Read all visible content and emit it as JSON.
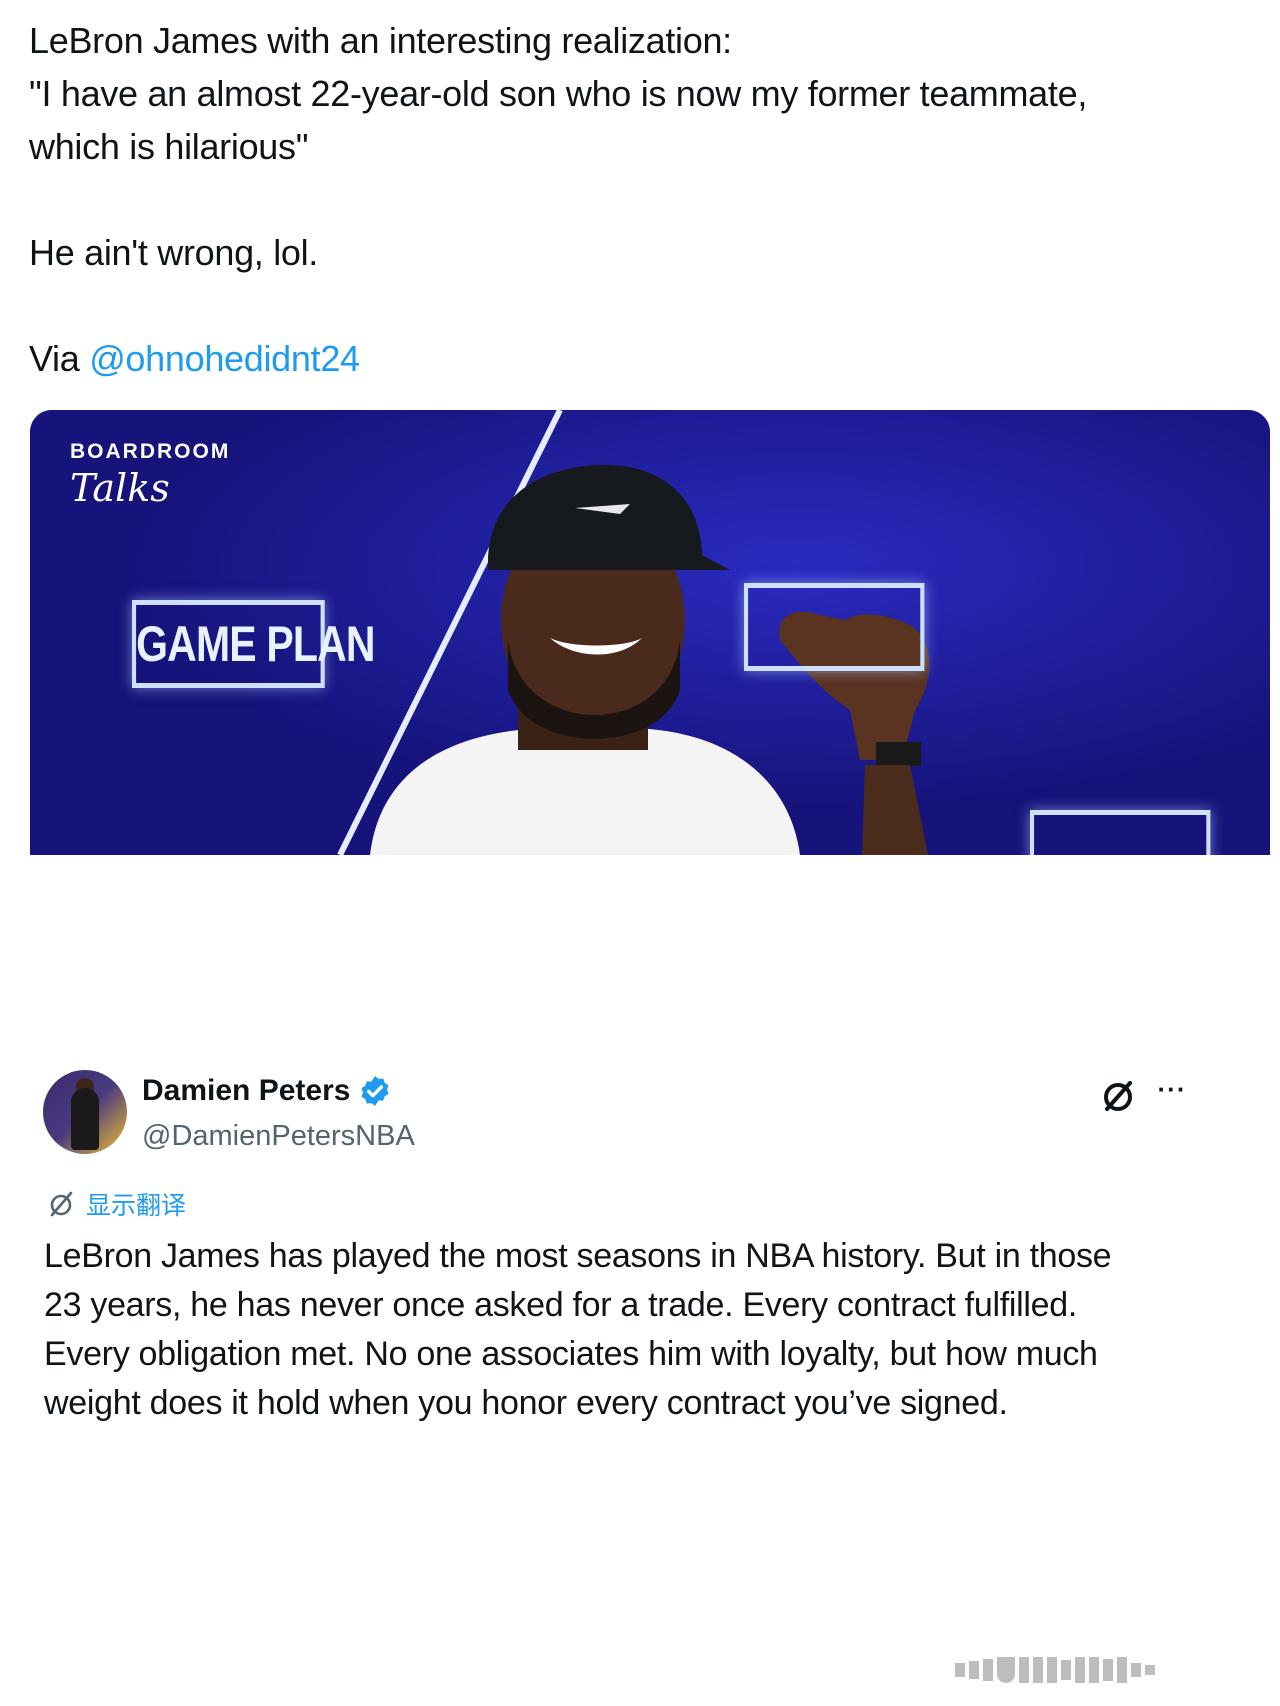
{
  "tweet1": {
    "lines": [
      "LeBron James with an interesting realization:",
      "\"I have an almost 22-year-old son who is now my former teammate,",
      "which is hilarious\"",
      "He ain't wrong, lol."
    ],
    "via_prefix": "Via ",
    "via_mention": "@ohnohedidnt24"
  },
  "media": {
    "brand_top": "BOARDROOM",
    "brand_bottom": "Talks",
    "sign_text": "GAME PLAN",
    "colors": {
      "background": "#1e1a96",
      "sign": "#cfe0ff"
    }
  },
  "tweet2": {
    "display_name": "Damien Peters",
    "handle": "@DamienPetersNBA",
    "translate_label": "显示翻译",
    "more_label": "···",
    "lines": [
      "LeBron James has played the most seasons in NBA history. But in those",
      "23 years, he has never once asked for a trade. Every contract fulfilled.",
      "Every obligation met. No one associates him with loyalty, but how much",
      "weight does it hold when you honor every contract you’ve signed."
    ],
    "icons": [
      "grok-icon",
      "more-icon",
      "verified-badge-icon",
      "translate-icon"
    ]
  },
  "colors": {
    "link": "#1d9bf0",
    "text": "#0f1419",
    "secondary": "#536471"
  }
}
